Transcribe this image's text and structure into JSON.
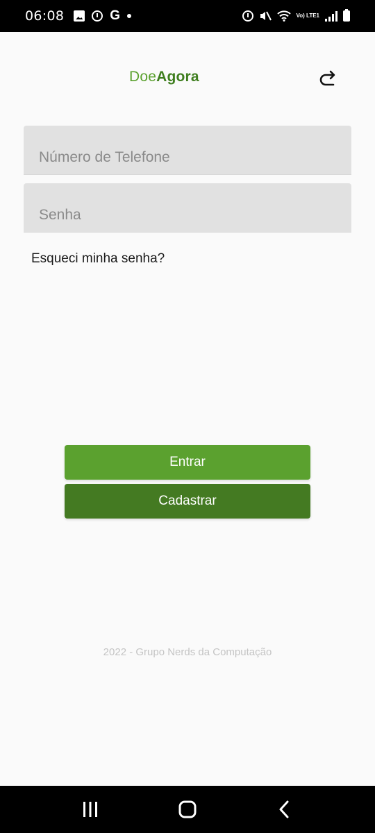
{
  "status_bar": {
    "time": "06:08",
    "g_label": "G",
    "volte_label": "Vo) LTE1"
  },
  "header": {
    "logo_part1": "Doe",
    "logo_part2": "Agora",
    "share_icon": "share-forward-icon"
  },
  "form": {
    "phone_placeholder": "Número de Telefone",
    "password_placeholder": "Senha",
    "forgot_label": "Esqueci minha senha?"
  },
  "buttons": {
    "login_label": "Entrar",
    "register_label": "Cadastrar"
  },
  "footer": {
    "text": "2022 - Grupo Nerds da Computação"
  },
  "colors": {
    "brand_light": "#5ba12f",
    "brand_dark": "#447a22",
    "input_bg": "#e1e1e1"
  },
  "nav": {
    "icons": [
      "recent-apps-icon",
      "home-icon",
      "back-icon"
    ]
  }
}
